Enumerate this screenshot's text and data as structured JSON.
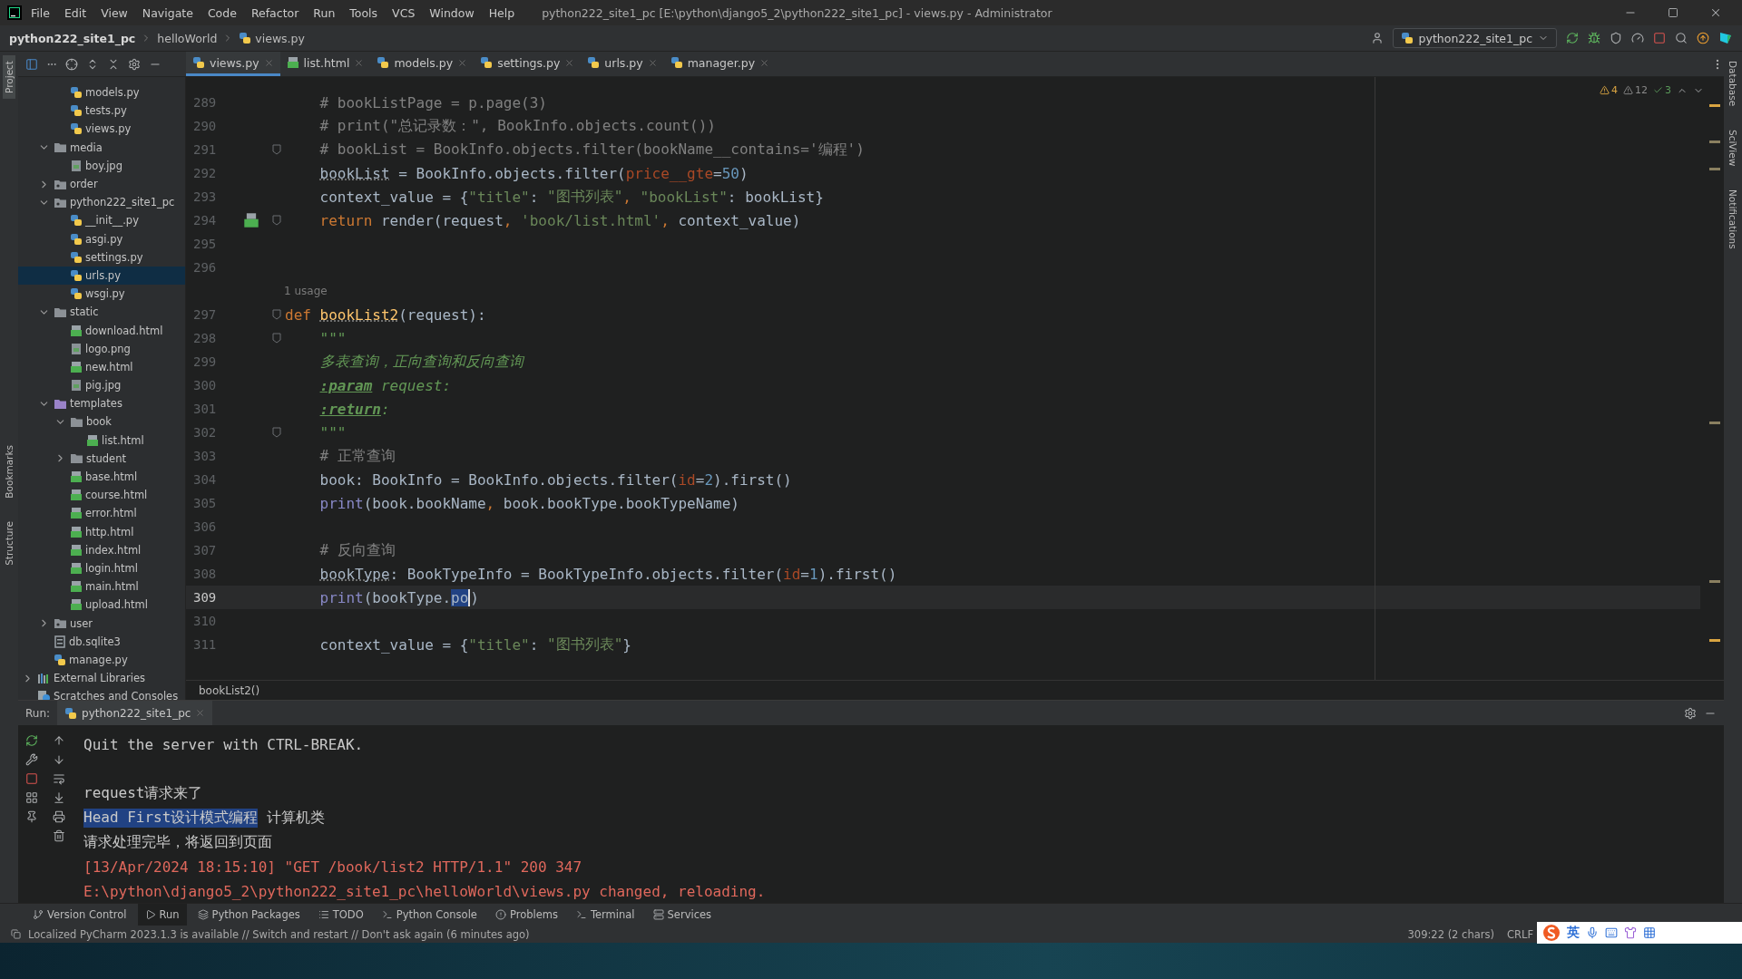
{
  "window": {
    "title": "python222_site1_pc [E:\\python\\django5_2\\python222_site1_pc] - views.py - Administrator"
  },
  "menu": [
    "File",
    "Edit",
    "View",
    "Navigate",
    "Code",
    "Refactor",
    "Run",
    "Tools",
    "VCS",
    "Window",
    "Help"
  ],
  "navigation": {
    "breadcrumbs": [
      {
        "label": "python222_site1_pc",
        "kind": "project"
      },
      {
        "label": "helloWorld",
        "kind": "folder"
      },
      {
        "label": "views.py",
        "kind": "file"
      }
    ],
    "run_configuration": "python222_site1_pc"
  },
  "left_stripe": {
    "top": [
      {
        "label": "Project",
        "selected": true
      }
    ],
    "bottom": [
      {
        "label": "Bookmarks",
        "selected": false
      },
      {
        "label": "Structure",
        "selected": false
      }
    ]
  },
  "right_stripe": [
    "Database",
    "SciView",
    "Notifications"
  ],
  "project_tree": {
    "clipped": [
      {
        "label": "models.py",
        "kind": "py",
        "selected": false
      },
      {
        "label": "tests.py",
        "kind": "py",
        "selected": false
      },
      {
        "label": "views.py",
        "kind": "py",
        "selected": false
      }
    ],
    "project": [
      {
        "label": "media",
        "kind": "folder",
        "expanded": true,
        "selected": false,
        "children": [
          {
            "label": "boy.jpg",
            "kind": "image",
            "selected": false
          }
        ]
      },
      {
        "label": "order",
        "kind": "package",
        "expanded": false,
        "selected": false
      },
      {
        "label": "python222_site1_pc",
        "kind": "package",
        "expanded": true,
        "selected": false,
        "children": [
          {
            "label": "__init__.py",
            "kind": "py",
            "selected": false
          },
          {
            "label": "asgi.py",
            "kind": "py",
            "selected": false
          },
          {
            "label": "settings.py",
            "kind": "py",
            "selected": false
          },
          {
            "label": "urls.py",
            "kind": "py",
            "selected": true
          },
          {
            "label": "wsgi.py",
            "kind": "py",
            "selected": false
          }
        ]
      },
      {
        "label": "static",
        "kind": "folder",
        "expanded": true,
        "selected": false,
        "children": [
          {
            "label": "download.html",
            "kind": "html",
            "selected": false
          },
          {
            "label": "logo.png",
            "kind": "image",
            "selected": false
          },
          {
            "label": "new.html",
            "kind": "html",
            "selected": false
          },
          {
            "label": "pig.jpg",
            "kind": "image",
            "selected": false
          }
        ]
      },
      {
        "label": "templates",
        "kind": "template-folder",
        "expanded": true,
        "selected": false,
        "children": [
          {
            "label": "book",
            "kind": "folder",
            "expanded": true,
            "selected": false,
            "children": [
              {
                "label": "list.html",
                "kind": "html",
                "selected": false
              }
            ]
          },
          {
            "label": "student",
            "kind": "folder",
            "expanded": false,
            "selected": false
          },
          {
            "label": "base.html",
            "kind": "html",
            "selected": false
          },
          {
            "label": "course.html",
            "kind": "html",
            "selected": false
          },
          {
            "label": "error.html",
            "kind": "html",
            "selected": false
          },
          {
            "label": "http.html",
            "kind": "html",
            "selected": false
          },
          {
            "label": "index.html",
            "kind": "html",
            "selected": false
          },
          {
            "label": "login.html",
            "kind": "html",
            "selected": false
          },
          {
            "label": "main.html",
            "kind": "html",
            "selected": false
          },
          {
            "label": "upload.html",
            "kind": "html",
            "selected": false
          }
        ]
      },
      {
        "label": "user",
        "kind": "package",
        "expanded": false,
        "selected": false
      },
      {
        "label": "db.sqlite3",
        "kind": "db",
        "selected": false
      },
      {
        "label": "manage.py",
        "kind": "py",
        "selected": false
      }
    ],
    "root": [
      {
        "label": "External Libraries",
        "kind": "library",
        "expanded": false,
        "selected": false
      },
      {
        "label": "Scratches and Consoles",
        "kind": "scratch",
        "selected": false
      }
    ]
  },
  "editor_tabs": [
    {
      "label": "views.py",
      "kind": "py",
      "selected": true
    },
    {
      "label": "list.html",
      "kind": "html",
      "selected": false
    },
    {
      "label": "models.py",
      "kind": "py",
      "selected": false
    },
    {
      "label": "settings.py",
      "kind": "py",
      "selected": false
    },
    {
      "label": "urls.py",
      "kind": "py",
      "selected": false
    },
    {
      "label": "manager.py",
      "kind": "py",
      "selected": false
    }
  ],
  "editor": {
    "inspections": {
      "warnings": "4",
      "weak_warnings": "12",
      "ok": "3"
    },
    "lines": [
      {
        "kind": "code",
        "number": "289",
        "indented": true,
        "fold": false,
        "current": false,
        "tokens": [
          {
            "kind": "comment",
            "text": "# bookListPage = p.page(3)"
          }
        ]
      },
      {
        "kind": "code",
        "number": "290",
        "indented": true,
        "fold": false,
        "current": false,
        "tokens": [
          {
            "kind": "comment",
            "text": "# print(\"总记录数：\", BookInfo.objects.count())"
          }
        ]
      },
      {
        "kind": "code",
        "number": "291",
        "indented": true,
        "fold": true,
        "current": false,
        "tokens": [
          {
            "kind": "comment",
            "text": "# bookList = BookInfo.objects.filter(bookName__contains='编程')"
          }
        ]
      },
      {
        "kind": "code",
        "number": "292",
        "indented": true,
        "fold": false,
        "current": false,
        "tokens": [
          {
            "kind": "underlined",
            "text": "bookList"
          },
          {
            "kind": "plain",
            "text": " = BookInfo.objects.filter("
          },
          {
            "kind": "param",
            "text": "price__gte"
          },
          {
            "kind": "plain",
            "text": "="
          },
          {
            "kind": "number",
            "text": "50"
          },
          {
            "kind": "plain",
            "text": ")"
          }
        ]
      },
      {
        "kind": "code",
        "number": "293",
        "indented": true,
        "fold": false,
        "current": false,
        "tokens": [
          {
            "kind": "plain",
            "text": "context_value = {"
          },
          {
            "kind": "string",
            "text": "\"title\""
          },
          {
            "kind": "plain",
            "text": ": "
          },
          {
            "kind": "string",
            "text": "\"图书列表\""
          },
          {
            "kind": "keyword",
            "text": ", "
          },
          {
            "kind": "string",
            "text": "\"bookList\""
          },
          {
            "kind": "plain",
            "text": ": bookList}"
          }
        ]
      },
      {
        "kind": "marked",
        "number": "294",
        "indented": true,
        "fold": true,
        "current": false,
        "tokens": [
          {
            "kind": "keyword",
            "text": "return"
          },
          {
            "kind": "plain",
            "text": " render(request"
          },
          {
            "kind": "keyword",
            "text": ", "
          },
          {
            "kind": "string",
            "text": "'book/list.html'"
          },
          {
            "kind": "keyword",
            "text": ", "
          },
          {
            "kind": "plain",
            "text": "context_value)"
          }
        ]
      },
      {
        "kind": "code",
        "number": "295",
        "fold": false,
        "current": false
      },
      {
        "kind": "code",
        "number": "296",
        "fold": false,
        "current": false
      },
      {
        "kind": "inlay",
        "text": "1 usage"
      },
      {
        "kind": "code",
        "number": "297",
        "indented": false,
        "fold": true,
        "current": false,
        "tokens": [
          {
            "kind": "keyword",
            "text": "def "
          },
          {
            "kind": "funcname",
            "text": "bookList2"
          },
          {
            "kind": "plain",
            "text": "(request):"
          }
        ]
      },
      {
        "kind": "code",
        "number": "298",
        "indented": true,
        "fold": true,
        "current": false,
        "tokens": [
          {
            "kind": "doc",
            "text": "\"\"\""
          }
        ]
      },
      {
        "kind": "code",
        "number": "299",
        "indented": true,
        "fold": false,
        "current": false,
        "tokens": [
          {
            "kind": "doc",
            "text": "多表查询，正向查询和反向查询"
          }
        ]
      },
      {
        "kind": "code",
        "number": "300",
        "indented": true,
        "fold": false,
        "current": false,
        "tokens": [
          {
            "kind": "doctag",
            "text": ":param"
          },
          {
            "kind": "doc",
            "text": " request:"
          }
        ]
      },
      {
        "kind": "code",
        "number": "301",
        "indented": true,
        "fold": false,
        "current": false,
        "tokens": [
          {
            "kind": "doctag",
            "text": ":return"
          },
          {
            "kind": "doc",
            "text": ":"
          }
        ]
      },
      {
        "kind": "code",
        "number": "302",
        "indented": true,
        "fold": true,
        "current": false,
        "tokens": [
          {
            "kind": "doc",
            "text": "\"\"\""
          }
        ]
      },
      {
        "kind": "code",
        "number": "303",
        "indented": true,
        "fold": false,
        "current": false,
        "tokens": [
          {
            "kind": "comment",
            "text": "# 正常查询"
          }
        ]
      },
      {
        "kind": "code",
        "number": "304",
        "indented": true,
        "fold": false,
        "current": false,
        "tokens": [
          {
            "kind": "plain",
            "text": "book: BookInfo = BookInfo.objects.filter("
          },
          {
            "kind": "param",
            "text": "id"
          },
          {
            "kind": "plain",
            "text": "="
          },
          {
            "kind": "number",
            "text": "2"
          },
          {
            "kind": "plain",
            "text": ").first()"
          }
        ]
      },
      {
        "kind": "code",
        "number": "305",
        "indented": true,
        "fold": false,
        "current": false,
        "tokens": [
          {
            "kind": "builtin",
            "text": "print"
          },
          {
            "kind": "plain",
            "text": "(book.bookName"
          },
          {
            "kind": "keyword",
            "text": ", "
          },
          {
            "kind": "plain",
            "text": "book.bookType.bookTypeName)"
          }
        ]
      },
      {
        "kind": "code",
        "number": "306",
        "fold": false,
        "current": false
      },
      {
        "kind": "code",
        "number": "307",
        "indented": true,
        "fold": false,
        "current": false,
        "tokens": [
          {
            "kind": "comment",
            "text": "# 反向查询"
          }
        ]
      },
      {
        "kind": "code",
        "number": "308",
        "indented": true,
        "fold": false,
        "current": false,
        "tokens": [
          {
            "kind": "underlined",
            "text": "bookType"
          },
          {
            "kind": "plain",
            "text": ": BookTypeInfo = BookTypeInfo.objects.filter("
          },
          {
            "kind": "param",
            "text": "id"
          },
          {
            "kind": "plain",
            "text": "="
          },
          {
            "kind": "number",
            "text": "1"
          },
          {
            "kind": "plain",
            "text": ").first()"
          }
        ]
      },
      {
        "kind": "code",
        "number": "309",
        "indented": true,
        "fold": false,
        "current": true,
        "tokens": [
          {
            "kind": "builtin",
            "text": "print"
          },
          {
            "kind": "plain",
            "text": "(bookType."
          },
          {
            "kind": "selection",
            "text": "po"
          },
          {
            "kind": "plain",
            "text": ")"
          }
        ]
      },
      {
        "kind": "code",
        "number": "310",
        "fold": false,
        "current": false
      },
      {
        "kind": "code",
        "number": "311",
        "indented": true,
        "fold": false,
        "current": false,
        "tokens": [
          {
            "kind": "plain",
            "text": "context_value = {"
          },
          {
            "kind": "string",
            "text": "\"title\""
          },
          {
            "kind": "plain",
            "text": ": "
          },
          {
            "kind": "string",
            "text": "\"图书列表\""
          },
          {
            "kind": "plain",
            "text": "}"
          }
        ]
      }
    ],
    "breadcrumb": "bookList2()"
  },
  "run_panel": {
    "label": "Run:",
    "tab": "python222_site1_pc",
    "output": [
      {
        "kind": "info",
        "segments": [
          {
            "text": "Quit the server with CTRL-BREAK.",
            "selected": false
          }
        ]
      },
      {
        "kind": "blank"
      },
      {
        "kind": "info",
        "segments": [
          {
            "text": "request请求来了",
            "selected": false
          }
        ]
      },
      {
        "kind": "info",
        "segments": [
          {
            "text": "Head First设计模式编程",
            "selected": true
          },
          {
            "text": "计算机类",
            "selected": false
          }
        ]
      },
      {
        "kind": "info",
        "segments": [
          {
            "text": "请求处理完毕，将返回到页面",
            "selected": false
          }
        ]
      },
      {
        "kind": "error",
        "segments": [
          {
            "text": "[13/Apr/2024 18:15:10] \"GET /book/list2 HTTP/1.1\" 200 347",
            "selected": false
          }
        ]
      },
      {
        "kind": "error",
        "segments": [
          {
            "text": "E:\\python\\django5_2\\python222_site1_pc\\helloWorld\\views.py changed, reloading.",
            "selected": false
          }
        ]
      }
    ]
  },
  "tool_tabs": [
    {
      "label": "Version Control",
      "kind": "vcs",
      "selected": false
    },
    {
      "label": "Run",
      "kind": "run",
      "selected": true
    },
    {
      "label": "Python Packages",
      "kind": "packages",
      "selected": false
    },
    {
      "label": "TODO",
      "kind": "todo",
      "selected": false
    },
    {
      "label": "Python Console",
      "kind": "console",
      "selected": false
    },
    {
      "label": "Problems",
      "kind": "problems",
      "selected": false
    },
    {
      "label": "Terminal",
      "kind": "terminal",
      "selected": false
    },
    {
      "label": "Services",
      "kind": "services",
      "selected": false
    }
  ],
  "status_bar": {
    "message": "Localized PyCharm 2023.1.3 is available // Switch and restart // Don't ask again (6 minutes ago)",
    "position": "309:22 (2 chars)",
    "line_separator": "CRLF"
  },
  "ime": {
    "language": "英"
  }
}
